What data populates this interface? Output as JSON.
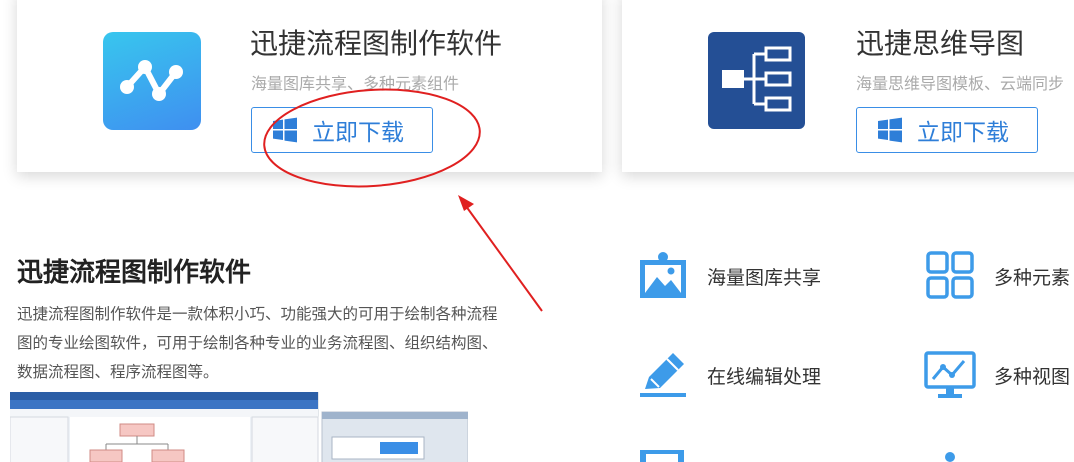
{
  "cards": [
    {
      "title": "迅捷流程图制作软件",
      "subtitle": "海量图库共享、多种元素组件",
      "download_label": "立即下载",
      "icon": "flowchart-app-icon"
    },
    {
      "title": "迅捷思维导图",
      "subtitle": "海量思维导图模板、云端同步",
      "download_label": "立即下载",
      "icon": "mindmap-app-icon"
    }
  ],
  "article": {
    "title": "迅捷流程图制作软件",
    "description": "迅捷流程图制作软件是一款体积小巧、功能强大的可用于绘制各种流程图的专业绘图软件，可用于绘制各种专业的业务流程图、组织结构图、数据流程图、程序流程图等。"
  },
  "features": [
    {
      "label": "海量图库共享",
      "icon": "image-gallery-icon"
    },
    {
      "label": "多种元素",
      "icon": "grid-icon"
    },
    {
      "label": "在线编辑处理",
      "icon": "pencil-edit-icon"
    },
    {
      "label": "多种视图",
      "icon": "monitor-chart-icon"
    }
  ],
  "colors": {
    "accent": "#3a8ee6",
    "annotation": "#e02020",
    "feature_icon": "#3d9be9"
  }
}
